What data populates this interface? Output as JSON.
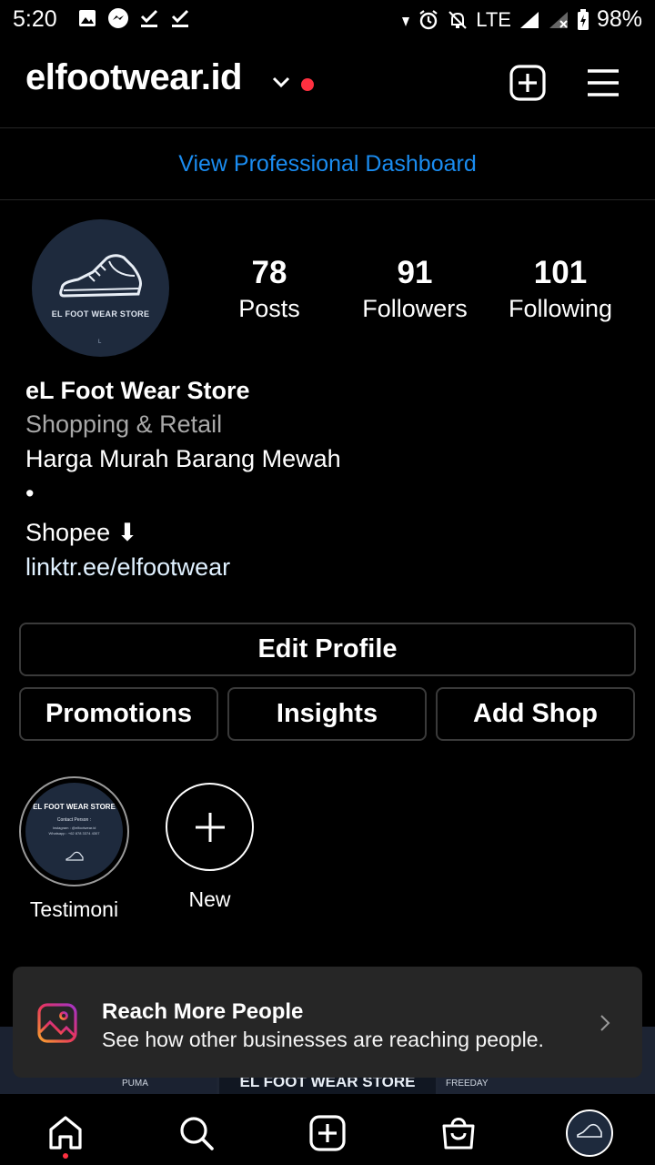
{
  "status_bar": {
    "time": "5:20",
    "network": "LTE",
    "battery": "98%"
  },
  "header": {
    "username": "elfootwear.id",
    "notification_color": "#ff3040"
  },
  "dashboard_link": "View Professional Dashboard",
  "profile": {
    "avatar_text": "EL FOOT WEAR STORE",
    "avatar_small": "L",
    "stats": [
      {
        "value": "78",
        "label": "Posts"
      },
      {
        "value": "91",
        "label": "Followers"
      },
      {
        "value": "101",
        "label": "Following"
      }
    ]
  },
  "bio": {
    "name": "eL Foot Wear Store",
    "category": "Shopping & Retail",
    "line1": "Harga Murah Barang Mewah",
    "line2": "•",
    "line3": "Shopee ⬇",
    "link": "linktr.ee/elfootwear"
  },
  "buttons": {
    "edit_profile": "Edit Profile",
    "promotions": "Promotions",
    "insights": "Insights",
    "add_shop": "Add Shop"
  },
  "highlights": [
    {
      "label": "Testimoni",
      "cover_title": "EL FOOT WEAR STORE",
      "cover_sub": "Contact Person :",
      "cover_line1": "Instagram : @elfootwear.id",
      "cover_line2": "Whatsapp : +62 878 3374 4307"
    },
    {
      "label": "New"
    }
  ],
  "grid_labels": [
    "PUMA",
    "EL FOOT WEAR STORE",
    "FREEDAY"
  ],
  "popup": {
    "title": "Reach More People",
    "subtitle": "See how other businesses are reaching people."
  },
  "colors": {
    "link_blue": "#1a8cf0",
    "background": "#000000",
    "popup_bg": "#262626"
  }
}
